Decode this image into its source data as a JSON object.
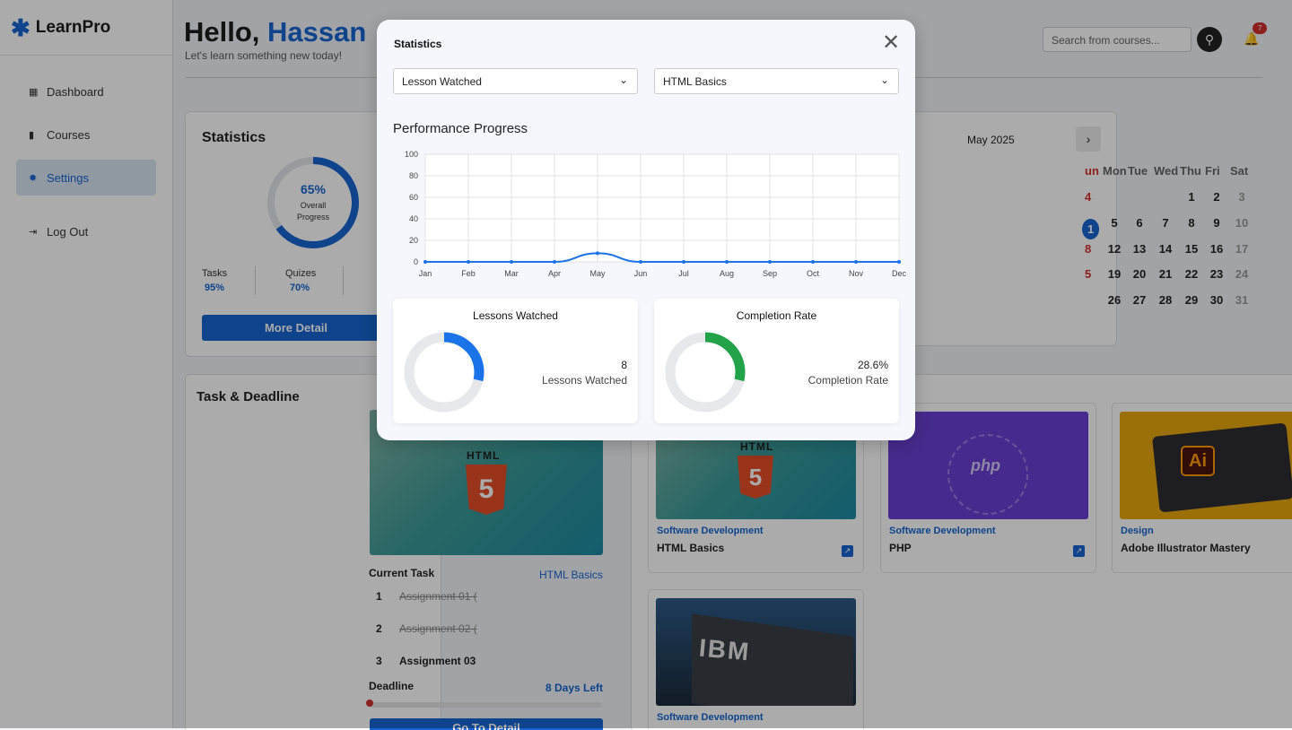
{
  "app": {
    "logo": "LearnPro"
  },
  "sidebar": {
    "items": [
      {
        "label": "Dashboard",
        "icon": "dashboard-icon"
      },
      {
        "label": "Courses",
        "icon": "book-icon"
      },
      {
        "label": "Settings",
        "icon": "gear-icon"
      },
      {
        "label": "Log Out",
        "icon": "logout-icon"
      }
    ],
    "active": "Settings"
  },
  "header": {
    "greeting": "Hello,",
    "name": "Hassan",
    "subtitle": "Let's learn something new today!",
    "search_placeholder": "Search from courses...",
    "notifications": "7"
  },
  "stats_card": {
    "title": "Statistics",
    "overall_pct": "65%",
    "overall_label_1": "Overall",
    "overall_label_2": "Progress",
    "overall_value": 0.65,
    "items": [
      {
        "label": "Tasks",
        "value": "95%"
      },
      {
        "label": "Quizes",
        "value": "70%"
      }
    ],
    "button": "More Detail"
  },
  "calendar": {
    "month": "May 2025",
    "weekdays": [
      "Mon",
      "Tue",
      "Wed",
      "Thu",
      "Fri",
      "Sat"
    ],
    "weeks": [
      [
        "",
        "",
        "",
        "1",
        "2",
        "3"
      ],
      [
        "5",
        "6",
        "7",
        "8",
        "9",
        "10"
      ],
      [
        "12",
        "13",
        "14",
        "15",
        "16",
        "17"
      ],
      [
        "19",
        "20",
        "21",
        "22",
        "23",
        "24"
      ],
      [
        "26",
        "27",
        "28",
        "29",
        "30",
        "31"
      ]
    ],
    "partial_left": [
      "un",
      "4",
      "1",
      "8",
      "5"
    ]
  },
  "tasks": {
    "title": "Task & Deadline",
    "current_task_label": "Current Task",
    "current_course": "HTML Basics",
    "items": [
      {
        "num": "1",
        "text": "Assignment 01 (",
        "done": true
      },
      {
        "num": "2",
        "text": "Assignment 02 (",
        "done": true
      },
      {
        "num": "3",
        "text": "Assignment 03",
        "done": false
      }
    ],
    "deadline_label": "Deadline",
    "deadline_value": "8 Days Left",
    "button": "Go To Detail"
  },
  "courses": [
    {
      "category": "Software Development",
      "name": "HTML Basics"
    },
    {
      "category": "Software Development",
      "name": "PHP"
    },
    {
      "category": "Design",
      "name": "Adobe Illustrator Mastery"
    },
    {
      "category": "Software Development",
      "name": ""
    }
  ],
  "modal": {
    "title": "Statistics",
    "select_metric": "Lesson Watched",
    "select_course": "HTML Basics",
    "chart_heading": "Performance Progress",
    "lessons": {
      "title": "Lessons Watched",
      "value": "8",
      "label": "Lessons Watched",
      "fraction": 0.286,
      "color": "#1a73e8"
    },
    "completion": {
      "title": "Completion Rate",
      "value": "28.6%",
      "label": "Completion Rate",
      "fraction": 0.286,
      "color": "#22a34a"
    }
  },
  "chart_data": {
    "type": "line",
    "categories": [
      "Jan",
      "Feb",
      "Mar",
      "Apr",
      "May",
      "Jun",
      "Jul",
      "Aug",
      "Sep",
      "Oct",
      "Nov",
      "Dec"
    ],
    "series": [
      {
        "values": [
          0,
          0,
          0,
          0,
          8,
          0,
          0,
          0,
          0,
          0,
          0,
          0
        ]
      }
    ],
    "ylim": [
      0,
      100
    ],
    "yticks": [
      0,
      20,
      40,
      60,
      80,
      100
    ],
    "grid": true,
    "color": "#1a73e8"
  }
}
